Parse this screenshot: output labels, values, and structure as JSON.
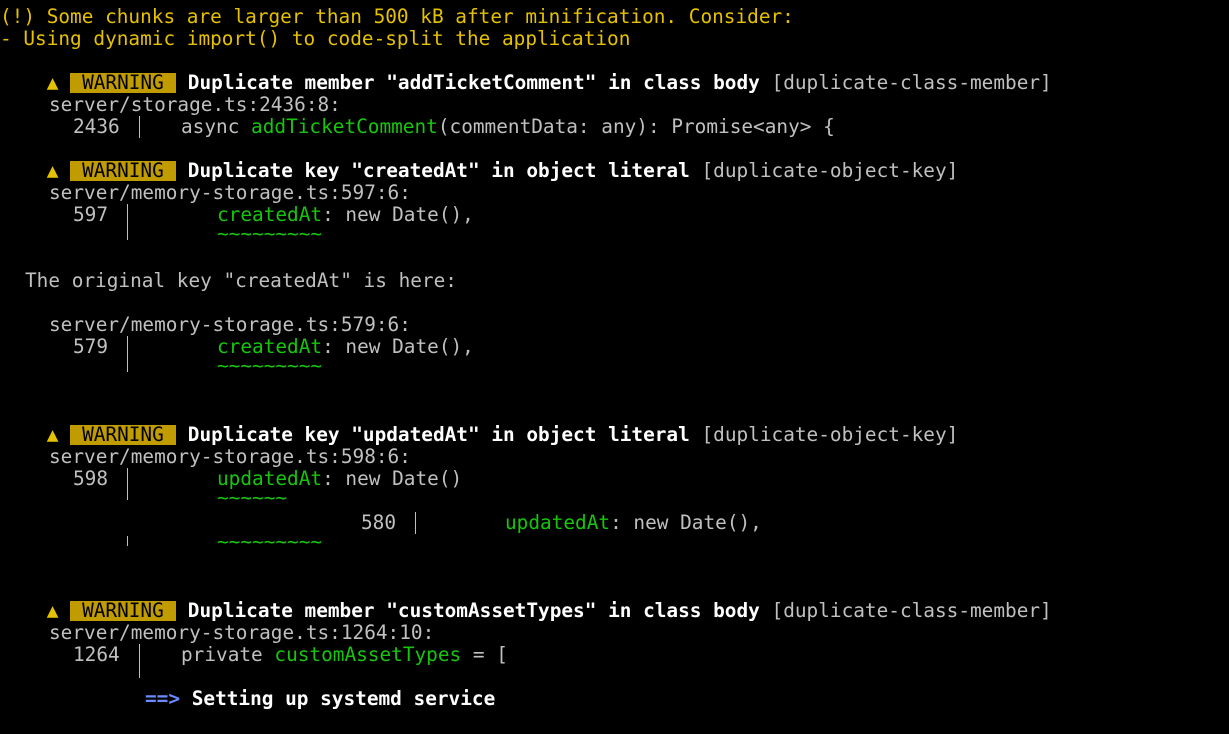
{
  "header": {
    "line1": "(!) Some chunks are larger than 500 kB after minification. Consider:",
    "line2": "- Using dynamic import() to code-split the application"
  },
  "icons": {
    "warning": "warning-triangle-icon",
    "arrow": "arrow-right-icon"
  },
  "warnings": [
    {
      "badge": "WARNING",
      "message": "Duplicate member \"addTicketComment\" in class body",
      "tag": "[duplicate-class-member]",
      "location": "server/storage.ts:2436:8:",
      "line_no": "2436",
      "code_pre": "async ",
      "code_hl": "addTicketComment",
      "code_post": "(commentData: any): Promise<any> {"
    },
    {
      "badge": "WARNING",
      "message": "Duplicate key \"createdAt\" in object literal",
      "tag": "[duplicate-object-key]",
      "location": "server/memory-storage.ts:597:6:",
      "line_no": "597",
      "code_hl": "createdAt",
      "code_post": ": new Date(),",
      "underline": "~~~~~~~~~",
      "note": "The original key \"createdAt\" is here:",
      "note_location": "server/memory-storage.ts:579:6:",
      "note_line_no": "579",
      "note_code_hl": "createdAt",
      "note_code_post": ": new Date(),",
      "note_underline": "~~~~~~~~~"
    },
    {
      "badge": "WARNING",
      "message": "Duplicate key \"updatedAt\" in object literal",
      "tag": "[duplicate-object-key]",
      "location": "server/memory-storage.ts:598:6:",
      "line_no": "598",
      "code_hl": "updatedAt",
      "code_post": ": new Date()",
      "underline": "~~~~~~",
      "overlap_line_no": "580",
      "overlap_code_hl": "updatedAt",
      "overlap_code_post": ": new Date(),",
      "overlap_underline": "~~~~~~~~~"
    },
    {
      "badge": "WARNING",
      "message": "Duplicate member \"customAssetTypes\" in class body",
      "tag": "[duplicate-class-member]",
      "location": "server/memory-storage.ts:1264:10:",
      "line_no": "1264",
      "code_pre": "private ",
      "code_hl": "customAssetTypes",
      "code_post": " = ["
    }
  ],
  "footer": {
    "arrow": "==>",
    "text": "Setting up systemd service"
  }
}
